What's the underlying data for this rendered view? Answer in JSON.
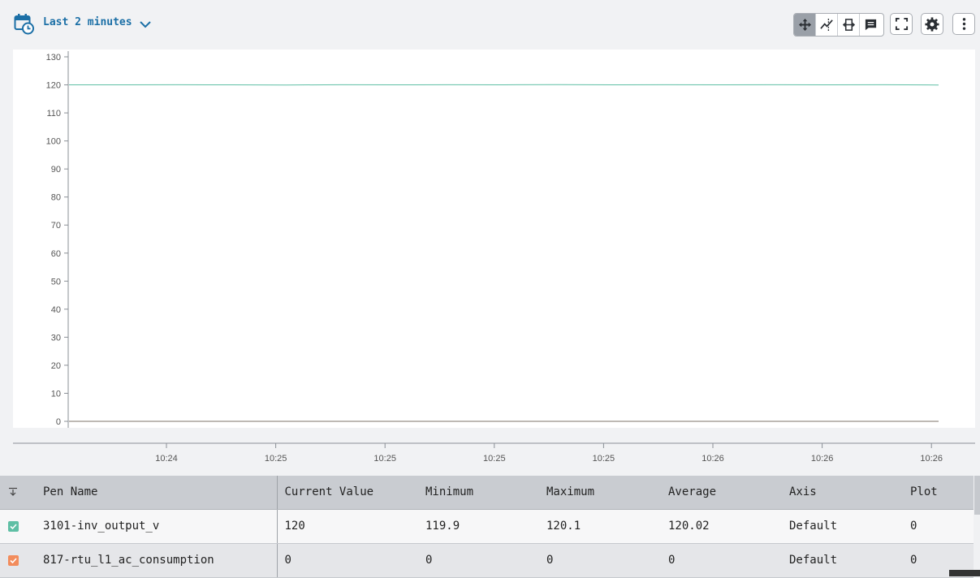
{
  "time_range": {
    "label": "Last 2 minutes"
  },
  "toolbar": {
    "pan_icon": "pan-arrows-icon",
    "crosshair_icon": "x-trace-icon",
    "zoom_icon": "zoom-horizontal-icon",
    "annotation_icon": "annotation-icon",
    "fullscreen_icon": "fullscreen-icon",
    "settings_icon": "gear-icon",
    "more_icon": "kebab-menu-icon"
  },
  "colors": {
    "accent": "#1b6fa6",
    "series_1": "#5fbfa5",
    "series_2": "#f28c5c"
  },
  "chart_data": {
    "type": "line",
    "ylim": [
      0,
      130
    ],
    "yticks": [
      "0",
      "10",
      "20",
      "30",
      "40",
      "50",
      "60",
      "70",
      "80",
      "90",
      "100",
      "110",
      "120",
      "130"
    ],
    "xtick_labels": [
      "10:24",
      "10:25",
      "10:25",
      "10:25",
      "10:25",
      "10:26",
      "10:26",
      "10:26"
    ],
    "x": [
      0,
      1,
      2,
      3,
      4,
      5,
      6,
      7,
      8,
      9,
      10,
      11,
      12,
      13,
      14,
      15,
      16
    ],
    "series": [
      {
        "name": "3101-inv_output_v",
        "color": "#5fbfa5",
        "values": [
          120.02,
          120.0,
          120.05,
          120.0,
          119.95,
          120.05,
          120.0,
          120.05,
          120.02,
          120.1,
          120.0,
          120.05,
          120.02,
          120.05,
          120.0,
          120.05,
          119.95
        ]
      },
      {
        "name": "817-rtu_l1_ac_consumption",
        "color": "#f28c5c",
        "values": [
          0,
          0,
          0,
          0,
          0,
          0,
          0,
          0,
          0,
          0,
          0,
          0,
          0,
          0,
          0,
          0,
          0
        ]
      }
    ]
  },
  "table": {
    "columns": [
      "Pen Name",
      "Current Value",
      "Minimum",
      "Maximum",
      "Average",
      "Axis",
      "Plot"
    ],
    "rows": [
      {
        "name": "3101-inv_output_v",
        "current": "120",
        "min": "119.9",
        "max": "120.1",
        "avg": "120.02",
        "axis": "Default",
        "plot": "0",
        "color": "#5fbfa5"
      },
      {
        "name": "817-rtu_l1_ac_consumption",
        "current": "0",
        "min": "0",
        "max": "0",
        "avg": "0",
        "axis": "Default",
        "plot": "0",
        "color": "#f28c5c"
      }
    ]
  }
}
